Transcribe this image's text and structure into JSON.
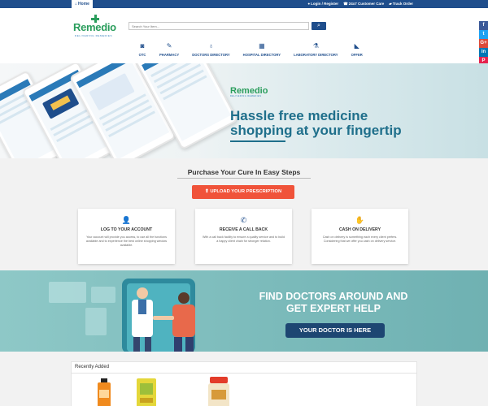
{
  "topbar": {
    "home_label": "Home",
    "links": [
      "Login / Register",
      "24x7 Customer Care",
      "Track Order"
    ]
  },
  "header": {
    "logo_word": "Remedio",
    "logo_tagline": "DELIVERING REMEDIES",
    "search_placeholder": "Search Your Item..."
  },
  "nav": [
    {
      "label": "OTC",
      "icon": "camera-icon"
    },
    {
      "label": "PHARMACY",
      "icon": "pill-icon"
    },
    {
      "label": "DOCTORS DIRECTORY",
      "icon": "stethoscope-icon"
    },
    {
      "label": "HOSPITAL DIRECTORY",
      "icon": "hospital-icon"
    },
    {
      "label": "LABORATORY DIRECTORY",
      "icon": "flask-icon"
    },
    {
      "label": "OFFER",
      "icon": "megaphone-icon"
    }
  ],
  "social": [
    {
      "label": "f",
      "color": "#3b5998",
      "icon": "facebook-icon"
    },
    {
      "label": "t",
      "color": "#1da1f2",
      "icon": "twitter-icon"
    },
    {
      "label": "G+",
      "color": "#dd4b39",
      "icon": "google-plus-icon"
    },
    {
      "label": "in",
      "color": "#0077b5",
      "icon": "linkedin-icon"
    },
    {
      "label": "P",
      "color": "#e6214c",
      "icon": "pinterest-icon"
    }
  ],
  "hero": {
    "logo_word": "Remedio",
    "logo_tagline": "DELIVERING REMEDIES",
    "title_line1": "Hassle free medicine",
    "title_line2": "shopping at your fingertip"
  },
  "steps": {
    "title": "Purchase Your Cure In Easy Steps",
    "upload_label": "UPLOAD YOUR PRESCRIPTION",
    "cards": [
      {
        "title": "LOG TO YOUR ACCOUNT",
        "desc": "Your account will provide you access, to use all the functions available and to experience the best online shopping window available."
      },
      {
        "title": "RECEIVE A CALL BACK",
        "desc": "With a call back facility to ensure a quality service and to build a happy client chain for stronger relation."
      },
      {
        "title": "CASH ON DELIVERY",
        "desc": "Cash on delivery is something each every client prefers. Considering that we offer you cash on delivery service."
      }
    ]
  },
  "doctor_banner": {
    "line1": "FIND DOCTORS AROUND AND",
    "line2": "GET EXPERT HELP",
    "button_label": "YOUR DOCTOR IS HERE"
  },
  "recent": {
    "title": "Recently Added"
  },
  "colors": {
    "brand_blue": "#1f4e8c",
    "brand_green": "#2a9d5c",
    "accent_orange": "#f0533a",
    "teal": "#1f6f8b"
  }
}
